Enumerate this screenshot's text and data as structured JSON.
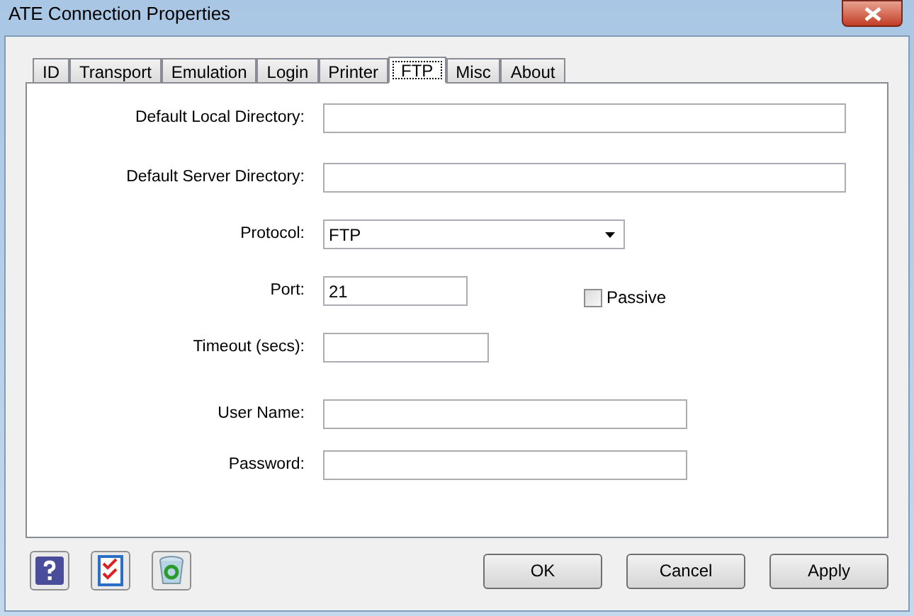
{
  "window": {
    "title": "ATE Connection Properties"
  },
  "tabs": [
    {
      "label": "ID",
      "selected": false
    },
    {
      "label": "Transport",
      "selected": false
    },
    {
      "label": "Emulation",
      "selected": false
    },
    {
      "label": "Login",
      "selected": false
    },
    {
      "label": "Printer",
      "selected": false
    },
    {
      "label": "FTP",
      "selected": true
    },
    {
      "label": "Misc",
      "selected": false
    },
    {
      "label": "About",
      "selected": false
    }
  ],
  "fields": [
    {
      "kind": "text",
      "label": "Default Local Directory:"
    },
    {
      "kind": "text",
      "label": "Default Server Directory:"
    },
    {
      "kind": "select",
      "label": "Protocol:",
      "value": "FTP"
    },
    {
      "kind": "text",
      "label": "Port:",
      "value": "21",
      "checkbox": {
        "label": "Passive",
        "checked": false
      }
    },
    {
      "kind": "text",
      "label": "Timeout (secs):"
    },
    {
      "kind": "text",
      "label": "User Name:"
    },
    {
      "kind": "text",
      "label": "Password:"
    }
  ],
  "buttons": [
    "OK",
    "Cancel",
    "Apply"
  ]
}
